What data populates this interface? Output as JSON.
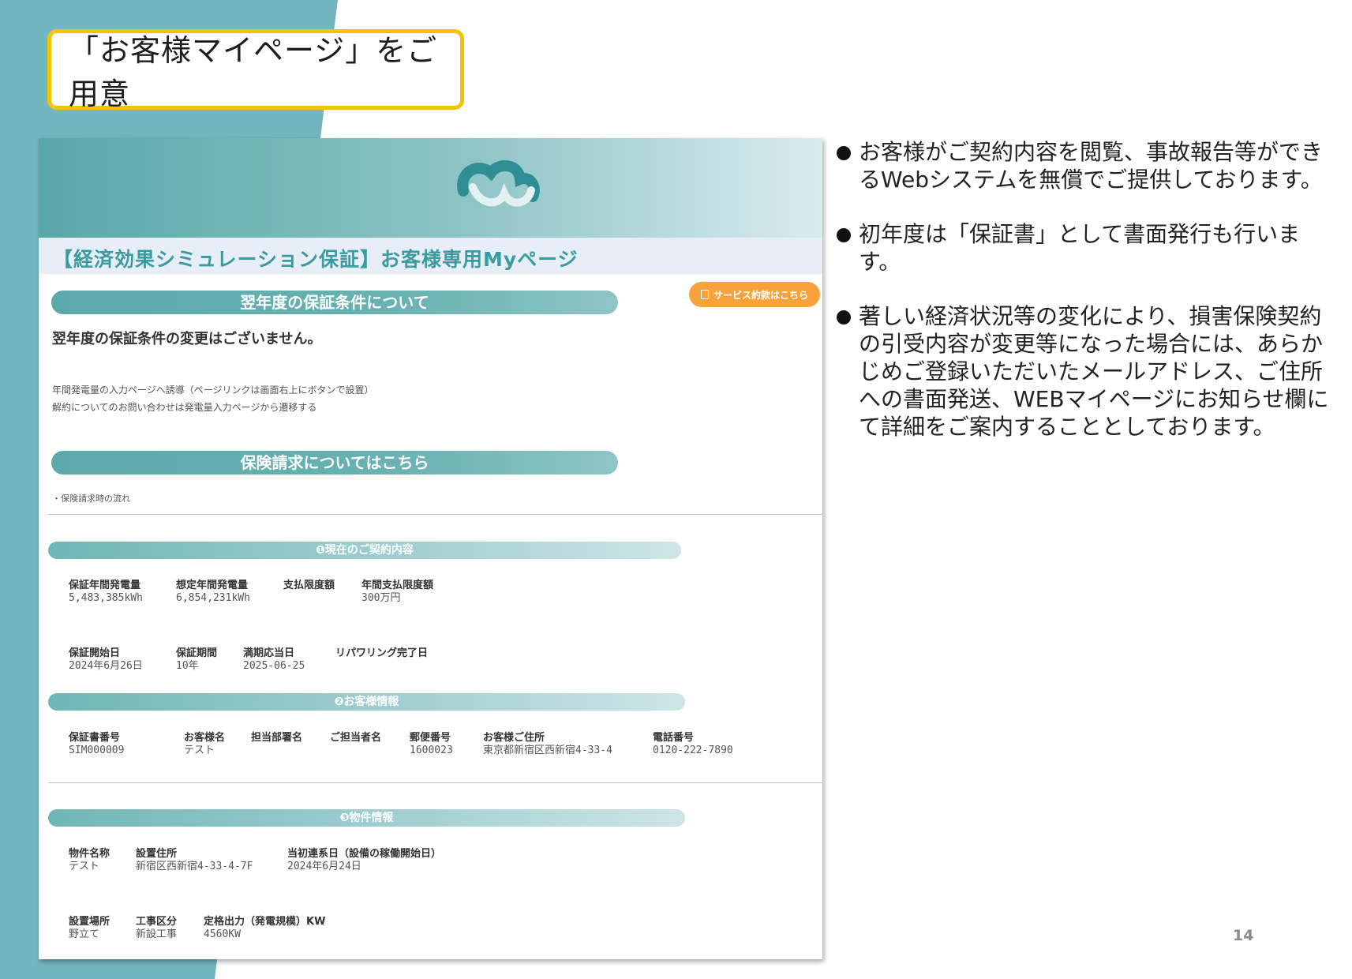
{
  "slide": {
    "title": "「お客様マイページ」をご用意",
    "page_number": "14"
  },
  "screenshot": {
    "page_title": "【経済効果シミュレーション保証】お客様専用Myページ",
    "section_next_year": "翌年度の保証条件について",
    "terms_button": "サービス約款はこちら",
    "no_change_message": "翌年度の保証条件の変更はございません。",
    "note_1": "年間発電量の入力ページへ誘導（ページリンクは画面右上にボタンで設置）",
    "note_2": "解約についてのお問い合わせは発電量入力ページから遷移する",
    "section_claims": "保険請求についてはこちら",
    "claims_flow_link": "・保険請求時の流れ",
    "section_contract": "❶現在のご契約内容",
    "contract_row1": [
      {
        "label": "保証年間発電量",
        "value": "5,483,385kWh"
      },
      {
        "label": "想定年間発電量",
        "value": "6,854,231kWh"
      },
      {
        "label": "支払限度額",
        "value": ""
      },
      {
        "label": "年間支払限度額",
        "value": "300万円"
      }
    ],
    "contract_row2": [
      {
        "label": "保証開始日",
        "value": "2024年6月26日"
      },
      {
        "label": "保証期間",
        "value": "10年"
      },
      {
        "label": "満期応当日",
        "value": "2025-06-25"
      },
      {
        "label": "リパワリング完了日",
        "value": ""
      }
    ],
    "section_customer": "❷お客様情報",
    "customer_row": [
      {
        "label": "保証書番号",
        "value": "SIM000009"
      },
      {
        "label": "お客様名",
        "value": "テスト"
      },
      {
        "label": "担当部署名",
        "value": ""
      },
      {
        "label": "ご担当者名",
        "value": ""
      },
      {
        "label": "郵便番号",
        "value": "1600023"
      },
      {
        "label": "お客様ご住所",
        "value": "東京都新宿区西新宿4-33-4"
      },
      {
        "label": "電話番号",
        "value": "0120-222-7890"
      }
    ],
    "section_property": "❸物件情報",
    "property_row1": [
      {
        "label": "物件名称",
        "value": "テスト"
      },
      {
        "label": "設置住所",
        "value": "新宿区西新宿4-33-4-7F"
      },
      {
        "label": "当初連系日（設備の稼働開始日）",
        "value": "2024年6月24日"
      }
    ],
    "property_row2": [
      {
        "label": "設置場所",
        "value": "野立て"
      },
      {
        "label": "工事区分",
        "value": "新設工事"
      },
      {
        "label": "定格出力（発電規模）KW",
        "value": "4560KW"
      }
    ]
  },
  "bullets": [
    "お客様がご契約内容を閲覧、事故報告等ができるWebシステムを無償でご提供しております。",
    "初年度は「保証書」として書面発行も行います。",
    "著しい経済状況等の変化により、損害保険契約の引受内容が変更等になった場合には、あらかじめご登録いただいたメールアドレス、ご住所への書面発送、WEBマイページにお知らせ欄にて詳細をご案内することとしております。"
  ],
  "colors": {
    "teal": "#5aa9ab",
    "title_border": "#f5c400",
    "button_orange": "#f7a23b",
    "page_title_text": "#3a9ba1"
  }
}
